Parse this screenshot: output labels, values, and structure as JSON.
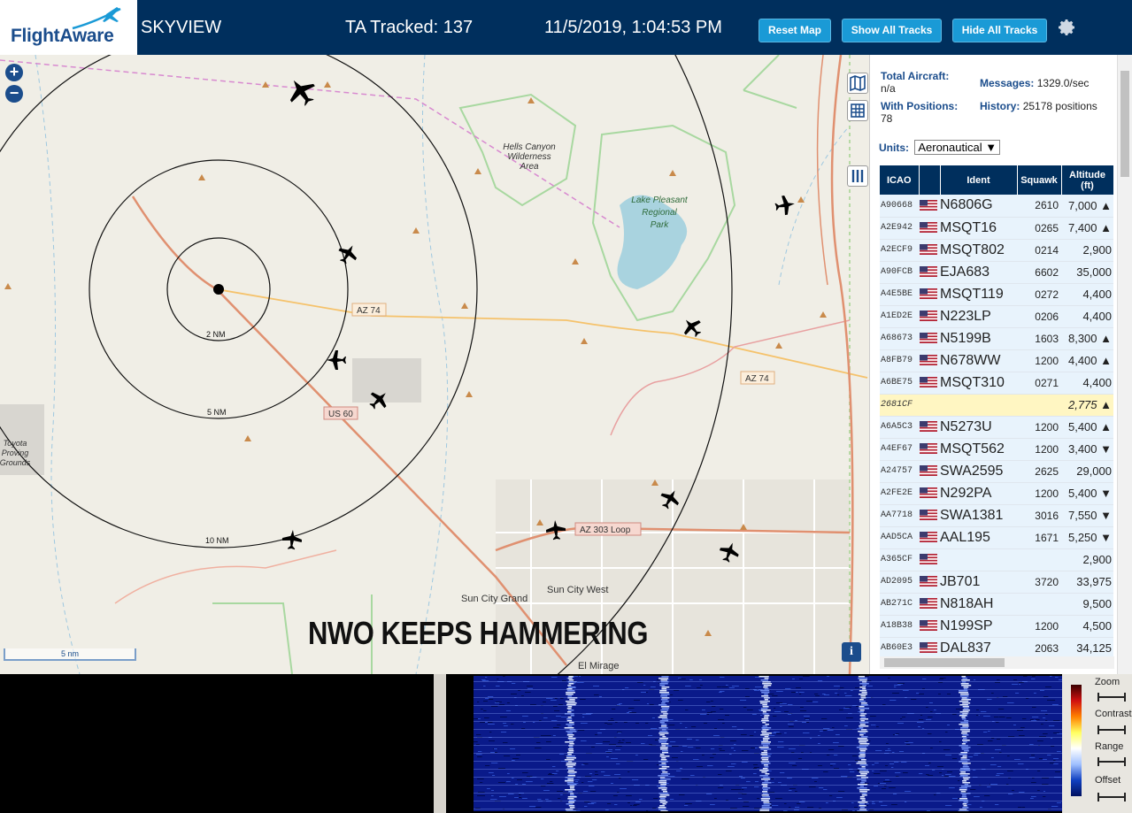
{
  "header": {
    "logo_text": "FlightAware",
    "app_title": "SKYVIEW",
    "tracked_label": "TA Tracked: 137",
    "datetime": "11/5/2019, 1:04:53 PM",
    "buttons": {
      "reset": "Reset Map",
      "show_all": "Show All Tracks",
      "hide_all": "Hide All Tracks"
    },
    "settings_icon": "gear-icon"
  },
  "map": {
    "zoom_in": "+",
    "zoom_out": "−",
    "range_rings": [
      "2 NM",
      "5 NM",
      "10 NM"
    ],
    "road_labels": [
      "AZ 74",
      "AZ 74",
      "US 60",
      "AZ 303 Loop"
    ],
    "place_labels": [
      "Hells Canyon Wilderness Area",
      "Lake Pleasant Regional Park",
      "Sun City West",
      "Sun City Grand",
      "El Mirage",
      "Toyota Proving Grounds"
    ],
    "scale_label": "5 nm",
    "info_button": "i",
    "overlay_caption": "NWO KEEPS HAMMERING"
  },
  "panel": {
    "total_aircraft_label": "Total Aircraft:",
    "total_aircraft_value": "n/a",
    "messages_label": "Messages:",
    "messages_value": "1329.0/sec",
    "with_positions_label": "With Positions:",
    "with_positions_value": "78",
    "history_label": "History:",
    "history_value": "25178 positions",
    "units_label": "Units:",
    "units_value": "Aeronautical",
    "columns": [
      "ICAO",
      "",
      "Ident",
      "Squawk",
      "Altitude (ft)"
    ],
    "rows": [
      {
        "icao": "A90668",
        "ident": "N6806G",
        "squawk": "2610",
        "alt": "7,000 ▲"
      },
      {
        "icao": "A2E942",
        "ident": "MSQT16",
        "squawk": "0265",
        "alt": "7,400 ▲"
      },
      {
        "icao": "A2ECF9",
        "ident": "MSQT802",
        "squawk": "0214",
        "alt": "2,900"
      },
      {
        "icao": "A90FCB",
        "ident": "EJA683",
        "squawk": "6602",
        "alt": "35,000"
      },
      {
        "icao": "A4E5BE",
        "ident": "MSQT119",
        "squawk": "0272",
        "alt": "4,400"
      },
      {
        "icao": "A1ED2E",
        "ident": "N223LP",
        "squawk": "0206",
        "alt": "4,400"
      },
      {
        "icao": "A68673",
        "ident": "N5199B",
        "squawk": "1603",
        "alt": "8,300 ▲"
      },
      {
        "icao": "A8FB79",
        "ident": "N678WW",
        "squawk": "1200",
        "alt": "4,400 ▲"
      },
      {
        "icao": "A6BE75",
        "ident": "MSQT310",
        "squawk": "0271",
        "alt": "4,400"
      },
      {
        "icao": "2681CF",
        "ident": "",
        "squawk": "",
        "alt": "2,775 ▲",
        "selected": true
      },
      {
        "icao": "A6A5C3",
        "ident": "N5273U",
        "squawk": "1200",
        "alt": "5,400 ▲"
      },
      {
        "icao": "A4EF67",
        "ident": "MSQT562",
        "squawk": "1200",
        "alt": "3,400 ▼"
      },
      {
        "icao": "A24757",
        "ident": "SWA2595",
        "squawk": "2625",
        "alt": "29,000"
      },
      {
        "icao": "A2FE2E",
        "ident": "N292PA",
        "squawk": "1200",
        "alt": "5,400 ▼"
      },
      {
        "icao": "AA7718",
        "ident": "SWA1381",
        "squawk": "3016",
        "alt": "7,550 ▼"
      },
      {
        "icao": "AAD5CA",
        "ident": "AAL195",
        "squawk": "1671",
        "alt": "5,250 ▼"
      },
      {
        "icao": "A365CF",
        "ident": "",
        "squawk": "",
        "alt": "2,900"
      },
      {
        "icao": "AD2095",
        "ident": "JB701",
        "squawk": "3720",
        "alt": "33,975"
      },
      {
        "icao": "AB271C",
        "ident": "N818AH",
        "squawk": "",
        "alt": "9,500"
      },
      {
        "icao": "A18B38",
        "ident": "N199SP",
        "squawk": "1200",
        "alt": "4,500"
      },
      {
        "icao": "AB60E3",
        "ident": "DAL837",
        "squawk": "2063",
        "alt": "34,125"
      }
    ]
  },
  "waterfall": {
    "controls": [
      "Zoom",
      "Contrast",
      "Range",
      "Offset"
    ]
  },
  "colors": {
    "header_bg": "#002f5d",
    "button_bg": "#1a9ad6",
    "row_bg": "#e8f3fc",
    "selected_row_bg": "#fff6c2",
    "aircraft": "#000000"
  }
}
